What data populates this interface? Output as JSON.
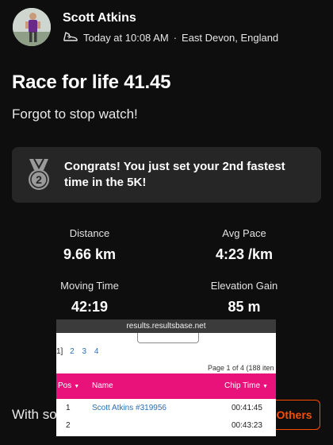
{
  "header": {
    "user_name": "Scott Atkins",
    "timestamp": "Today at 10:08 AM",
    "separator": "·",
    "location": "East Devon, England",
    "activity_icon": "running-shoe-icon"
  },
  "activity": {
    "title": "Race for life 41.45",
    "description": "Forgot to stop watch!"
  },
  "achievement": {
    "icon": "medal-icon",
    "rank": "2",
    "text": "Congrats! You just set your 2nd fastest time in the 5K!"
  },
  "stats": [
    {
      "label": "Distance",
      "value": "9.66 km"
    },
    {
      "label": "Avg Pace",
      "value": "4:23 /km"
    },
    {
      "label": "Moving Time",
      "value": "42:19"
    },
    {
      "label": "Elevation Gain",
      "value": "85 m"
    }
  ],
  "footer": {
    "with_text": "With so",
    "others_button": "Others"
  },
  "overlay": {
    "url": "results.resultsbase.net",
    "pager_fragment": "1]",
    "pages": [
      "2",
      "3",
      "4"
    ],
    "page_info": "Page 1 of 4 (188 iten",
    "columns": {
      "pos": "Pos",
      "name": "Name",
      "chip_time": "Chip Time"
    },
    "rows": [
      {
        "pos": "1",
        "name": "Scott Atkins #319956",
        "time": "00:41:45"
      },
      {
        "pos": "2",
        "name": "",
        "time": "00:43:23"
      }
    ]
  },
  "colors": {
    "accent": "#fc4c02",
    "background": "#0e0e0e",
    "card": "#262626",
    "table_header": "#e8127a",
    "link": "#2a6fb5"
  }
}
